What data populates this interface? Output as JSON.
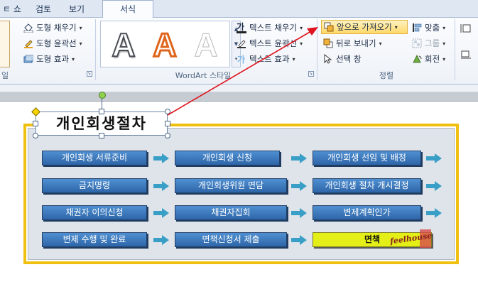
{
  "tabs": [
    {
      "label": "ㅌ 쇼",
      "active": false
    },
    {
      "label": "검토",
      "active": false
    },
    {
      "label": "보기",
      "active": false
    },
    {
      "label": "서식",
      "active": true
    }
  ],
  "ribbon": {
    "shape_styles": {
      "fill": "도형 채우기",
      "outline": "도형 윤곽선",
      "effects": "도형 효과",
      "title_partial": "일"
    },
    "wordart": {
      "samples": [
        "A",
        "A",
        "A"
      ],
      "text_fill": "텍스트 채우기",
      "text_outline": "텍스트 윤곽선",
      "text_effects": "텍스트 효과",
      "text_fill_icon": "가",
      "title": "WordArt 스타일"
    },
    "arrange": {
      "bring_forward": "앞으로 가져오기",
      "send_backward": "뒤로 보내기",
      "selection_pane": "선택 창",
      "align": "맞춤",
      "group": "그룹",
      "rotate": "회전",
      "title": "정렬"
    }
  },
  "diagram": {
    "title": "개인회생절차",
    "rows": [
      [
        "개인회생 서류준비",
        "개인회생 신청",
        "개인회생 선임 및 배정"
      ],
      [
        "금지명령",
        "개인회생위원 면담",
        "개인회생 절차 개시결정"
      ],
      [
        "채권자 이의신청",
        "채권자집회",
        "변제계획인가"
      ],
      [
        "변제 수행 및 완료",
        "면책신청서 제출",
        "면책"
      ]
    ],
    "watermark": "feelhouse"
  },
  "colors": {
    "box_blue": "#2e66a8",
    "arrow_teal": "#3a9fc6",
    "frame_yellow": "#f0c010",
    "final_box": "#e3ef17",
    "annotation_red": "#e0141e"
  }
}
